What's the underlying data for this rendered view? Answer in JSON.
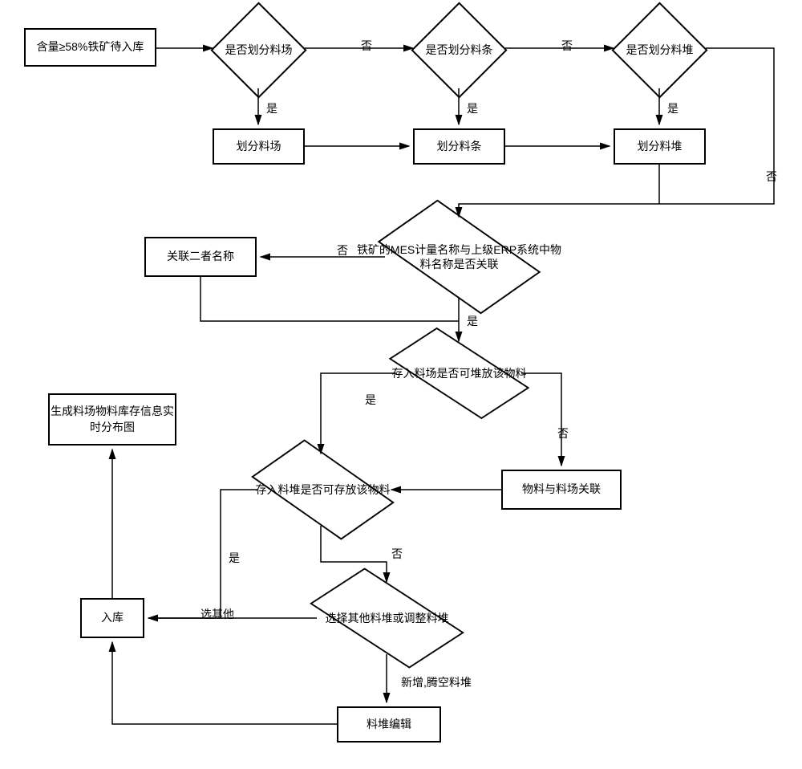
{
  "flowchart": {
    "start": "含量≥58%铁矿待入库",
    "q_yard": "是否划分料场",
    "q_strip": "是否划分料条",
    "q_pile": "是否划分料堆",
    "act_divide_yard": "划分料场",
    "act_divide_strip": "划分料条",
    "act_divide_pile": "划分料堆",
    "q_mes_erp": "铁矿的MES计量名称与上级ERP系统中物料名称是否关联",
    "act_associate_names": "关联二者名称",
    "q_yard_can_store": "存入料场是否可堆放该物料",
    "act_mat_yard_link": "物料与料场关联",
    "q_pile_can_store": "存入料堆是否可存放该物料",
    "q_choose_other": "选择其他料堆或调整料堆",
    "act_pile_edit": "料堆编辑",
    "act_store": "入库",
    "act_report": "生成料场物料库存信息实时分布图"
  },
  "labels": {
    "yes": "是",
    "no": "否",
    "choose_other": "选其他",
    "add_empty": "新增,腾空料堆"
  }
}
